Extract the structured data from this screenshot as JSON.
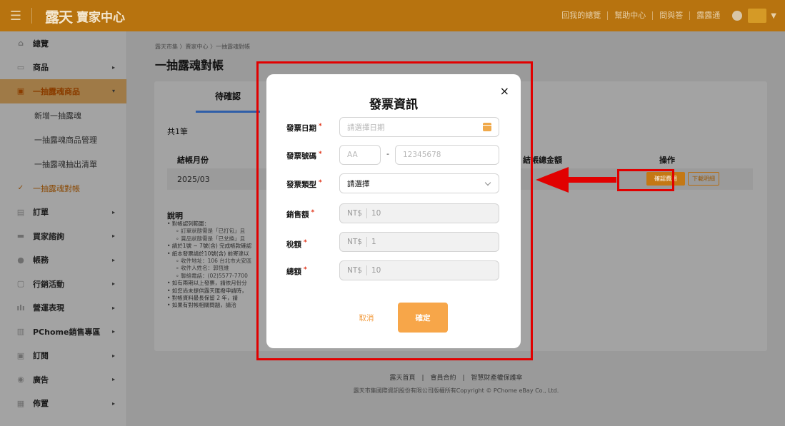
{
  "topbar": {
    "logo_mark": "露天",
    "logo_title": "賣家中心",
    "links": [
      "回我的總覽",
      "幫助中心",
      "問與答",
      "露露通"
    ],
    "colors": {
      "bar": "#b7730f",
      "accent": "#f7a649"
    }
  },
  "sidebar": {
    "items": [
      {
        "label": "總覽",
        "icon": "home-icon"
      },
      {
        "label": "商品",
        "icon": "shop-icon"
      },
      {
        "label": "一抽露魂商品",
        "icon": "gift-icon"
      },
      {
        "label": "訂單",
        "icon": "doc-icon"
      },
      {
        "label": "買家諮詢",
        "icon": "chat-icon"
      },
      {
        "label": "帳務",
        "icon": "coin-icon"
      },
      {
        "label": "行銷活動",
        "icon": "calendar-icon"
      },
      {
        "label": "營運表現",
        "icon": "bar-chart-icon"
      },
      {
        "label": "PChome銷售專區",
        "icon": "store-icon"
      },
      {
        "label": "訂閱",
        "icon": "subscribe-icon"
      },
      {
        "label": "廣告",
        "icon": "ad-icon"
      },
      {
        "label": "佈置",
        "icon": "layout-icon"
      }
    ],
    "subitems": [
      "新增一抽露魂",
      "一抽露魂商品管理",
      "一抽露魂抽出清單",
      "一抽露魂對帳"
    ]
  },
  "main": {
    "breadcrumb": "露天市集 〉賣家中心 〉一抽露魂對帳",
    "title": "一抽露魂對帳",
    "tab_label": "待確認",
    "total": "共1筆",
    "col_month": "結帳月份",
    "col_amount": "結帳總金額",
    "col_action": "操作",
    "row_month": "2025/03",
    "btn_confirm_fee": "確認費用",
    "btn_detail": "下載明細",
    "notes_title": "說明",
    "notes": [
      "• 對帳認列範圍：",
      "∘ 訂單狀態需是「已打包」且",
      "∘ 賞品狀態需是「已兌換」且",
      "• 請於1號 ~ 7號(含) 完成帳款確認",
      "• 紙本發票請於10號(含) 前寄達以",
      "∘ 收件地址：106 台北市大安區",
      "∘ 收件人姓名：郭恆維",
      "∘ 聯絡電話：(02)5577-7700",
      "• 如有兩期以上發票，請依月份分",
      "• 如您尚未提供露天匯撥申請時，",
      "• 對帳資料最長保留 2 年，請",
      "• 如果有對帳相關問題，請洽"
    ],
    "footer_links": "露天首頁　|　會員合約　|　智慧財產權保護傘",
    "copyright": "露天市集國際資訊股份有限公司版權所有Copyright © PChome eBay Co., Ltd."
  },
  "modal": {
    "title": "發票資訊",
    "date_label": "發票日期",
    "date_placeholder": "請選擇日期",
    "number_label": "發票號碼",
    "number_prefix_placeholder": "AA",
    "number_dash": "-",
    "number_placeholder": "12345678",
    "type_label": "發票類型",
    "type_value": "請選擇",
    "sales_label": "銷售額",
    "sales_value": "10",
    "tax_label": "稅額",
    "tax_value": "1",
    "total_label": "總額",
    "total_value": "10",
    "currency": "NT$",
    "cancel": "取消",
    "ok": "確定",
    "close": "×",
    "required_mark": "*"
  }
}
